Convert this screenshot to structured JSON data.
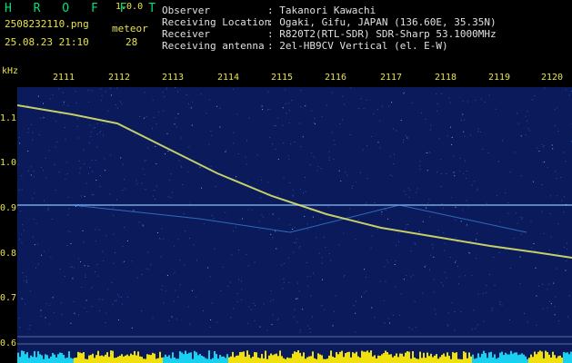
{
  "app": {
    "logo": "H R O F F T",
    "version": "1.0.0"
  },
  "capture": {
    "filename": "2508232110.png",
    "datetime": "25.08.23 21:10",
    "meteor_label": "meteor",
    "meteor_count": "28"
  },
  "station": [
    {
      "key": "Observer",
      "value": ": Takanori Kawachi"
    },
    {
      "key": "Receiving Location",
      "value": ": Ogaki, Gifu, JAPAN (136.60E, 35.35N)"
    },
    {
      "key": "Receiver",
      "value": ": R820T2(RTL-SDR) SDR-Sharp 53.1000MHz"
    },
    {
      "key": "Receiving antenna",
      "value": ": 2el-HB9CV Vertical (el. E-W)"
    }
  ],
  "axis": {
    "unit": "kHz",
    "y_ticks": [
      "1.1",
      "1.0",
      "0.9",
      "0.8",
      "0.7",
      "0.6"
    ],
    "x_ticks": [
      "2111",
      "2112",
      "2113",
      "2114",
      "2115",
      "2116",
      "2117",
      "2118",
      "2119",
      "2120"
    ]
  },
  "colors": {
    "background": "#0a1a5a",
    "trace": "#e8f06a",
    "label": "#e8e24a",
    "logo": "#00e07a",
    "bars_cyan": "#18d0f0",
    "bars_yellow": "#f0e010"
  }
}
